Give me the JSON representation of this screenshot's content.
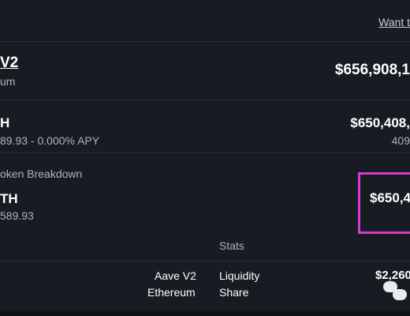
{
  "header": {
    "link_text": "Want t"
  },
  "protocol": {
    "name": "V2",
    "network_partial": "um",
    "total_value": "$656,908,1"
  },
  "asset_row": {
    "symbol_partial": "H",
    "details": "89.93 - 0.000% APY",
    "value": "$650,408,",
    "sub_value": "409"
  },
  "breakdown": {
    "heading": "oken Breakdown",
    "symbol_partial": "TH",
    "amount": "589.93",
    "value": "$650,4"
  },
  "stats": {
    "heading": "Stats",
    "protocol": "Aave V2",
    "network": "Ethereum",
    "metric_line1": "Liquidity",
    "metric_line2": "Share",
    "metric_value": "$2,260"
  },
  "colors": {
    "background": "#171b22",
    "divider": "#2b3039",
    "highlight": "#d43bd6"
  }
}
